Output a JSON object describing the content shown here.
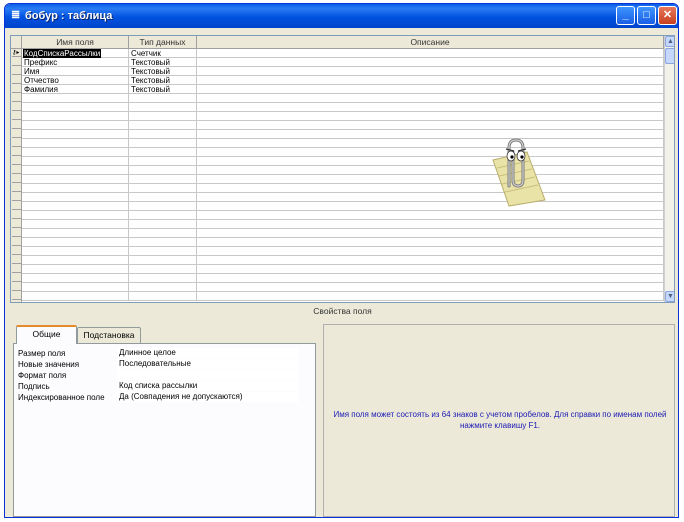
{
  "window": {
    "title": "бобур : таблица",
    "icon": "table-icon"
  },
  "grid": {
    "columns": [
      "Имя поля",
      "Тип данных",
      "Описание"
    ],
    "rows": [
      {
        "name": "КодСпискаРассылки",
        "type": "Счетчик",
        "key": true
      },
      {
        "name": "Префикс",
        "type": "Текстовый"
      },
      {
        "name": "Имя",
        "type": "Текстовый"
      },
      {
        "name": "Отчество",
        "type": "Текстовый"
      },
      {
        "name": "Фамилия",
        "type": "Текстовый"
      }
    ]
  },
  "field_properties": {
    "title": "Свойства поля",
    "tabs": [
      "Общие",
      "Подстановка"
    ],
    "active_tab": "Общие",
    "properties": [
      {
        "label": "Размер поля",
        "value": "Длинное целое"
      },
      {
        "label": "Новые значения",
        "value": "Последовательные"
      },
      {
        "label": "Формат поля",
        "value": ""
      },
      {
        "label": "Подпись",
        "value": "Код списка рассылки"
      },
      {
        "label": "Индексированное поле",
        "value": "Да (Совпадения не допускаются)"
      }
    ],
    "help_text": "Имя поля может состоять из 64 знаков с учетом пробелов.  Для справки по именам полей нажмите клавишу F1."
  },
  "colors": {
    "titlebar": "#0052e0",
    "help_text": "#1a1ab5",
    "window_bg": "#ece9d8"
  }
}
